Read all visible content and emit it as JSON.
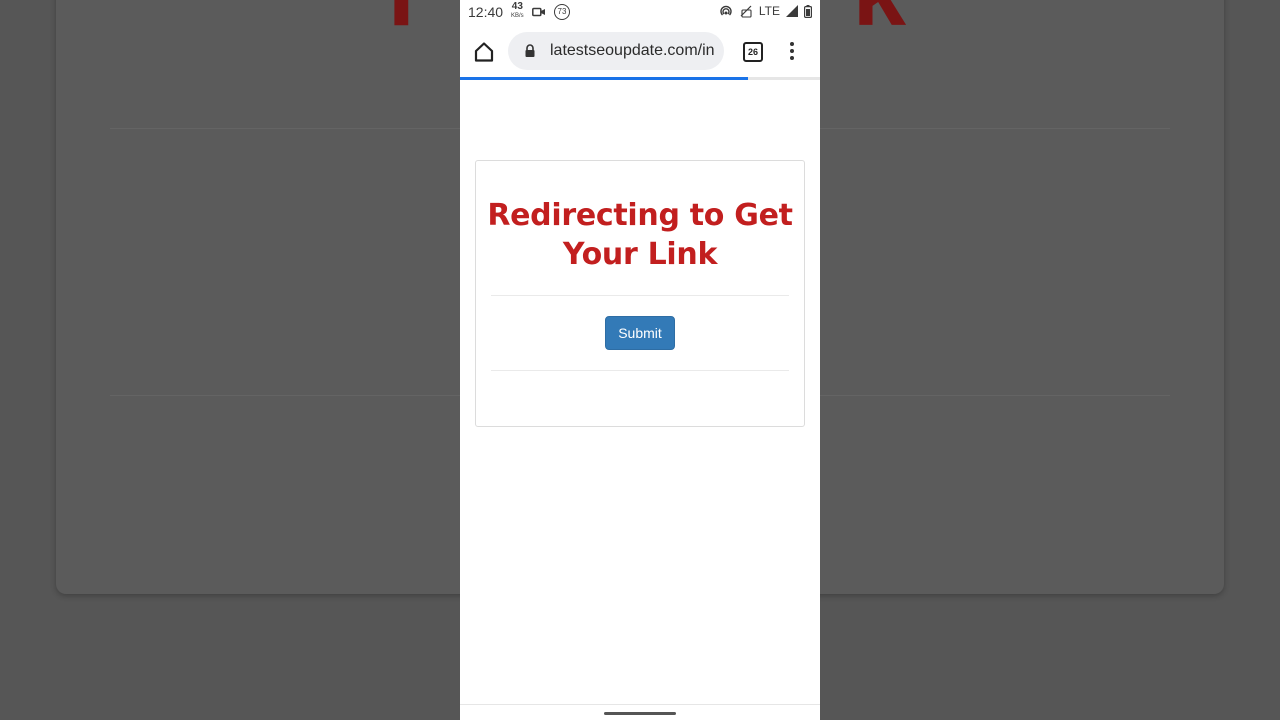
{
  "background": {
    "title_fragments": [
      "T",
      "k"
    ]
  },
  "status_bar": {
    "time": "12:40",
    "speed_value": "43",
    "speed_unit": "KB/s",
    "badge_number": "73",
    "network_label": "LTE",
    "icons": [
      "video-camera-icon",
      "hotspot-icon",
      "volte-icon",
      "signal-icon",
      "battery-icon"
    ]
  },
  "browser": {
    "url": "latestseoupdate.com/in",
    "tab_count": "26",
    "load_progress": 0.8,
    "accent_color": "#1a73e8"
  },
  "page": {
    "heading": "Redirecting to Get Your Link",
    "heading_color": "#c21f1f",
    "submit_label": "Submit",
    "button_color": "#337ab7"
  }
}
